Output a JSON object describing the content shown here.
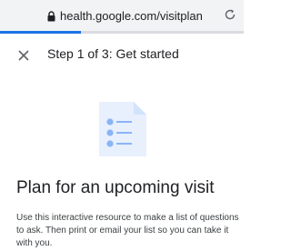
{
  "browser": {
    "url": "health.google.com/visitplan"
  },
  "progress": {
    "current_step": 1,
    "total_steps": 3,
    "fraction": 0.333
  },
  "header": {
    "step_title": "Step 1 of 3: Get started"
  },
  "main": {
    "heading": "Plan for an upcoming visit",
    "description": "Use this interactive resource to make a list of questions to ask. Then print or email your list so you can take it with you."
  },
  "colors": {
    "accent": "#1a73e8",
    "illustration_bg": "#e8f0fe",
    "illustration_line": "#8ab4f8",
    "text_primary": "#202124"
  },
  "icons": {
    "lock": "lock-icon",
    "reload": "reload-icon",
    "close": "close-icon",
    "checklist": "checklist-icon"
  }
}
